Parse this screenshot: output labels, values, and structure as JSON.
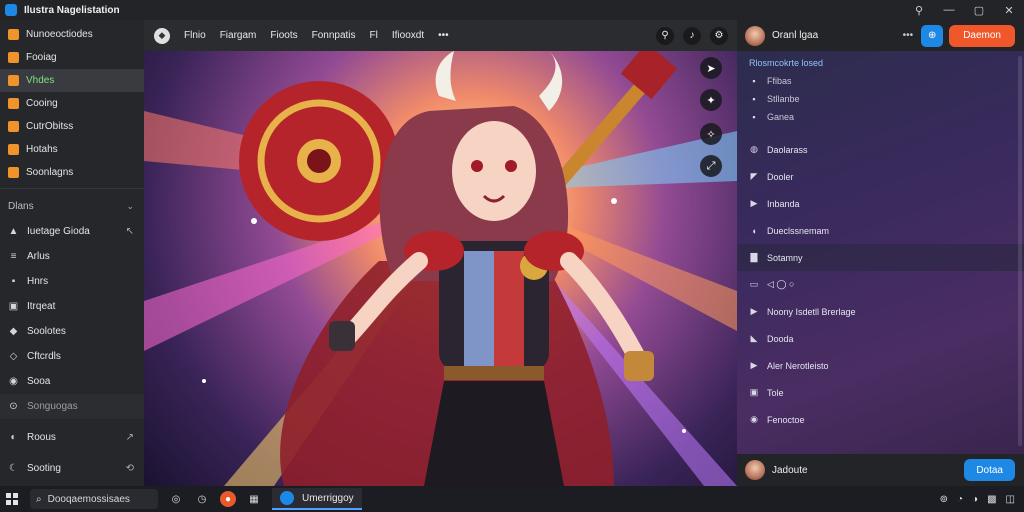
{
  "window": {
    "title": "Ilustra Nagelistation",
    "icon": "app-icon",
    "controls": [
      "pin-icon",
      "minimize-icon",
      "maximize-icon",
      "close-icon"
    ]
  },
  "sidebar": {
    "top_items": [
      {
        "label": "Nunoeoctiodes",
        "icon": "home-icon"
      },
      {
        "label": "Fooiag",
        "icon": "folder-icon"
      },
      {
        "label": "Vhdes",
        "icon": "folder-icon",
        "active": true
      },
      {
        "label": "Cooing",
        "icon": "folder-icon"
      },
      {
        "label": "CutrObitss",
        "icon": "folder-icon"
      },
      {
        "label": "Hotahs",
        "icon": "folder-icon"
      },
      {
        "label": "Soonlagns",
        "icon": "folder-icon"
      }
    ],
    "section_label": "Dlans",
    "items": [
      {
        "label": "Iuetage Gioda",
        "glyph": "▲",
        "tail": "↖"
      },
      {
        "label": "Arlus",
        "glyph": "≡",
        "tail": ""
      },
      {
        "label": "Hnrs",
        "glyph": "▪",
        "tail": ""
      },
      {
        "label": "Itrqeat",
        "glyph": "▣",
        "tail": ""
      },
      {
        "label": "Soolotes",
        "glyph": "◆",
        "tail": ""
      },
      {
        "label": "Cftcrdls",
        "glyph": "◇",
        "tail": ""
      },
      {
        "label": "Sooa",
        "glyph": "◉",
        "tail": ""
      },
      {
        "label": "Songuogas",
        "glyph": "⊙",
        "tail": "",
        "dim": true
      },
      {
        "label": "Roous",
        "glyph": "◐",
        "tail": "↗"
      },
      {
        "label": "Sooting",
        "glyph": "☾",
        "tail": "⟲"
      }
    ]
  },
  "topbar": {
    "tabs": [
      "Flnio",
      "Fiargam",
      "Fioots",
      "Fonnpatis",
      "Fl",
      "Ifiooxdt",
      "•••"
    ],
    "icons": [
      "pin-icon",
      "bell-icon",
      "settings-icon"
    ]
  },
  "canvas": {
    "float_icons": [
      "cursor-icon",
      "sparkle-icon",
      "magic-icon",
      "expand-icon"
    ]
  },
  "right_panel": {
    "user_name": "Oranl lgaa",
    "dots": "•••",
    "action_label": "Daemon",
    "heading": "Rlosmcokrte losed",
    "small_items": [
      {
        "label": "Ffibas",
        "glyph": "▪"
      },
      {
        "label": "Stllanbe",
        "glyph": "▪"
      },
      {
        "label": "Ganea",
        "glyph": "▪"
      }
    ],
    "items": [
      {
        "label": "Daolarass",
        "glyph": "◍"
      },
      {
        "label": "Dooler",
        "glyph": "◤"
      },
      {
        "label": "Inbanda",
        "glyph": "▶"
      },
      {
        "label": "Dueclssnemam",
        "glyph": "◖"
      },
      {
        "label": "Sotamny",
        "glyph": "▇",
        "highlight": true
      },
      {
        "label": "◁ ◯ ○",
        "glyph": "▭"
      },
      {
        "label": "Noony Isdetll Brerlage",
        "glyph": "▶"
      },
      {
        "label": "Dooda",
        "glyph": "◣"
      },
      {
        "label": "Aler Nerotleisto",
        "glyph": "▶"
      },
      {
        "label": "Tole",
        "glyph": "▣"
      },
      {
        "label": "Fenoctoe",
        "glyph": "◉"
      }
    ],
    "bottom_name": "Jadoute",
    "send_label": "Dotaa"
  },
  "taskbar": {
    "search_text": "Dooqaemossisaes",
    "icons": [
      "edge-icon",
      "clock-icon",
      "brand-icon",
      "grid-icon"
    ],
    "active_app": "Umerriggoy",
    "tray": [
      "network-icon",
      "volume-icon",
      "battery-icon",
      "notification-icon",
      "chat-icon"
    ]
  },
  "colors": {
    "accent_blue": "#1e88e5",
    "accent_orange": "#f0582b",
    "active_green": "#7ee081"
  }
}
